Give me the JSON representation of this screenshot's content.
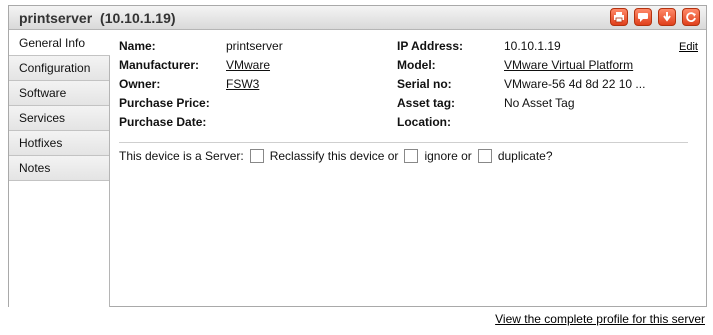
{
  "header": {
    "device_name": "printserver",
    "device_ip": "(10.10.1.19)",
    "actions": [
      {
        "name": "print-icon",
        "label": "Print"
      },
      {
        "name": "comment-icon",
        "label": "Comment"
      },
      {
        "name": "download-icon",
        "label": "Download"
      },
      {
        "name": "refresh-icon",
        "label": "Refresh"
      }
    ],
    "accent_color": "#e0401c"
  },
  "tabs": [
    {
      "label": "General Info",
      "active": true
    },
    {
      "label": "Configuration",
      "active": false
    },
    {
      "label": "Software",
      "active": false
    },
    {
      "label": "Services",
      "active": false
    },
    {
      "label": "Hotfixes",
      "active": false
    },
    {
      "label": "Notes",
      "active": false
    }
  ],
  "edit_label": "Edit",
  "left_fields": {
    "name": {
      "label": "Name:",
      "value": "printserver"
    },
    "manufacturer": {
      "label": "Manufacturer:",
      "value": "VMware"
    },
    "owner": {
      "label": "Owner:",
      "value": "FSW3"
    },
    "purchase_price": {
      "label": "Purchase Price:",
      "value": ""
    },
    "purchase_date": {
      "label": "Purchase Date:",
      "value": ""
    }
  },
  "right_fields": {
    "ip_address": {
      "label": "IP Address:",
      "value": "10.10.1.19"
    },
    "model": {
      "label": "Model:",
      "value": "VMware Virtual Platform"
    },
    "serial_no": {
      "label": "Serial no:",
      "value": "VMware-56 4d 8d 22 10 ..."
    },
    "asset_tag": {
      "label": "Asset tag:",
      "value": "No Asset Tag"
    },
    "location": {
      "label": "Location:",
      "value": ""
    }
  },
  "server_row": {
    "is_server_label": "This device is a Server:",
    "reclassify_label": "Reclassify this device or",
    "ignore_label": "ignore or",
    "duplicate_label": "duplicate?"
  },
  "footer": {
    "profile_link": "View the complete profile for this server"
  }
}
